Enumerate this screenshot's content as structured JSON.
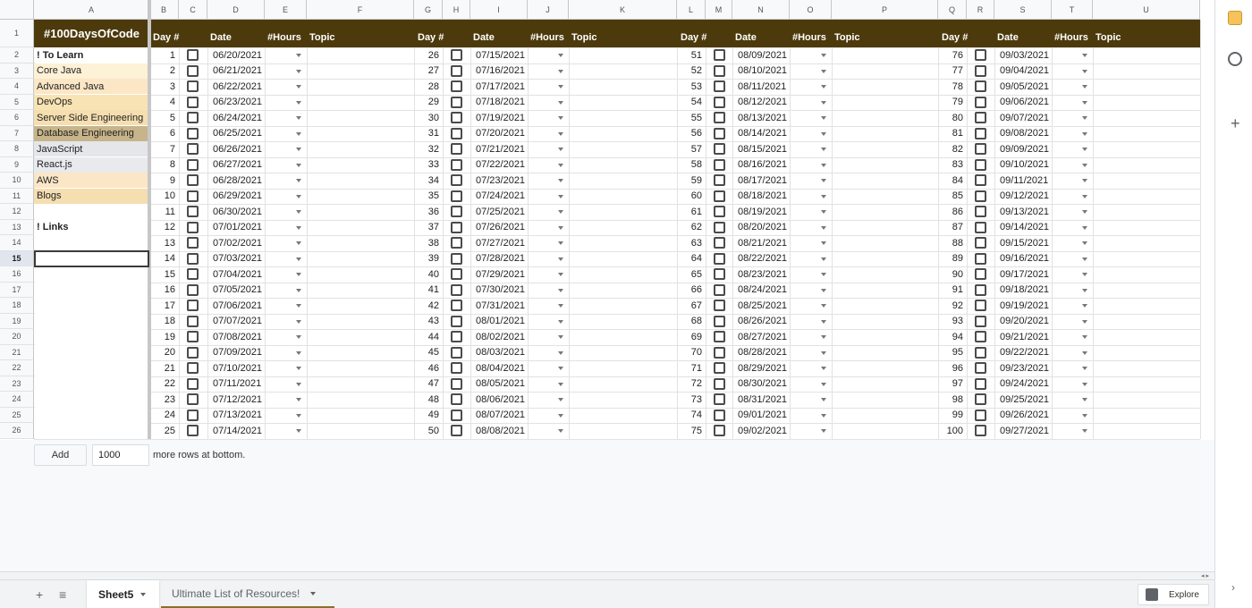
{
  "columns": [
    "A",
    "B",
    "C",
    "D",
    "E",
    "F",
    "G",
    "H",
    "I",
    "J",
    "K",
    "L",
    "M",
    "N",
    "O",
    "P",
    "Q",
    "R",
    "S",
    "T",
    "U"
  ],
  "rows": [
    "1",
    "2",
    "3",
    "4",
    "5",
    "6",
    "7",
    "8",
    "9",
    "10",
    "11",
    "12",
    "13",
    "14",
    "15",
    "16",
    "17",
    "18",
    "19",
    "20",
    "21",
    "22",
    "23",
    "24",
    "25",
    "26"
  ],
  "title": "#100DaysOfCode",
  "header_labels": {
    "day": "Day #",
    "date": "Date",
    "hours": "#Hours",
    "topic": "Topic"
  },
  "col_a": [
    "! To Learn",
    "Core Java",
    "Advanced Java",
    "DevOps",
    "Server Side Engineering",
    "Database Engineering",
    "JavaScript",
    "React.js",
    "AWS",
    "Blogs",
    "",
    "! Links",
    "",
    "",
    "",
    "",
    "",
    "",
    "",
    "",
    "",
    "",
    "",
    "",
    ""
  ],
  "col_a_colors": [
    "#ffffff",
    "#fdf1d6",
    "#fbe6c6",
    "#f8e3b4",
    "#f5deb0",
    "#c7b48a",
    "#e4e6ea",
    "#e9eaee",
    "#fbe6c6",
    "#f5deb0"
  ],
  "blocks": [
    {
      "days": [
        "1",
        "2",
        "3",
        "4",
        "5",
        "6",
        "7",
        "8",
        "9",
        "10",
        "11",
        "12",
        "13",
        "14",
        "15",
        "16",
        "17",
        "18",
        "19",
        "20",
        "21",
        "22",
        "23",
        "24",
        "25"
      ],
      "dates": [
        "06/20/2021",
        "06/21/2021",
        "06/22/2021",
        "06/23/2021",
        "06/24/2021",
        "06/25/2021",
        "06/26/2021",
        "06/27/2021",
        "06/28/2021",
        "06/29/2021",
        "06/30/2021",
        "07/01/2021",
        "07/02/2021",
        "07/03/2021",
        "07/04/2021",
        "07/05/2021",
        "07/06/2021",
        "07/07/2021",
        "07/08/2021",
        "07/09/2021",
        "07/10/2021",
        "07/11/2021",
        "07/12/2021",
        "07/13/2021",
        "07/14/2021"
      ]
    },
    {
      "days": [
        "26",
        "27",
        "28",
        "29",
        "30",
        "31",
        "32",
        "33",
        "34",
        "35",
        "36",
        "37",
        "38",
        "39",
        "40",
        "41",
        "42",
        "43",
        "44",
        "45",
        "46",
        "47",
        "48",
        "49",
        "50"
      ],
      "dates": [
        "07/15/2021",
        "07/16/2021",
        "07/17/2021",
        "07/18/2021",
        "07/19/2021",
        "07/20/2021",
        "07/21/2021",
        "07/22/2021",
        "07/23/2021",
        "07/24/2021",
        "07/25/2021",
        "07/26/2021",
        "07/27/2021",
        "07/28/2021",
        "07/29/2021",
        "07/30/2021",
        "07/31/2021",
        "08/01/2021",
        "08/02/2021",
        "08/03/2021",
        "08/04/2021",
        "08/05/2021",
        "08/06/2021",
        "08/07/2021",
        "08/08/2021"
      ]
    },
    {
      "days": [
        "51",
        "52",
        "53",
        "54",
        "55",
        "56",
        "57",
        "58",
        "59",
        "60",
        "61",
        "62",
        "63",
        "64",
        "65",
        "66",
        "67",
        "68",
        "69",
        "70",
        "71",
        "72",
        "73",
        "74",
        "75"
      ],
      "dates": [
        "08/09/2021",
        "08/10/2021",
        "08/11/2021",
        "08/12/2021",
        "08/13/2021",
        "08/14/2021",
        "08/15/2021",
        "08/16/2021",
        "08/17/2021",
        "08/18/2021",
        "08/19/2021",
        "08/20/2021",
        "08/21/2021",
        "08/22/2021",
        "08/23/2021",
        "08/24/2021",
        "08/25/2021",
        "08/26/2021",
        "08/27/2021",
        "08/28/2021",
        "08/29/2021",
        "08/30/2021",
        "08/31/2021",
        "09/01/2021",
        "09/02/2021"
      ]
    },
    {
      "days": [
        "76",
        "77",
        "78",
        "79",
        "80",
        "81",
        "82",
        "83",
        "84",
        "85",
        "86",
        "87",
        "88",
        "89",
        "90",
        "91",
        "92",
        "93",
        "94",
        "95",
        "96",
        "97",
        "98",
        "99",
        "100"
      ],
      "dates": [
        "09/03/2021",
        "09/04/2021",
        "09/05/2021",
        "09/06/2021",
        "09/07/2021",
        "09/08/2021",
        "09/09/2021",
        "09/10/2021",
        "09/11/2021",
        "09/12/2021",
        "09/13/2021",
        "09/14/2021",
        "09/15/2021",
        "09/16/2021",
        "09/17/2021",
        "09/18/2021",
        "09/19/2021",
        "09/20/2021",
        "09/21/2021",
        "09/22/2021",
        "09/23/2021",
        "09/24/2021",
        "09/25/2021",
        "09/26/2021",
        "09/27/2021"
      ]
    }
  ],
  "add_rows": {
    "button": "Add",
    "count": "1000",
    "suffix": "more rows at bottom."
  },
  "tabs": [
    {
      "label": "Sheet5"
    },
    {
      "label": "Ultimate List of Resources!"
    }
  ],
  "explore": "Explore",
  "colors": {
    "header_bg": "#4d3a0c",
    "selected_border": "#3a3a3a"
  }
}
